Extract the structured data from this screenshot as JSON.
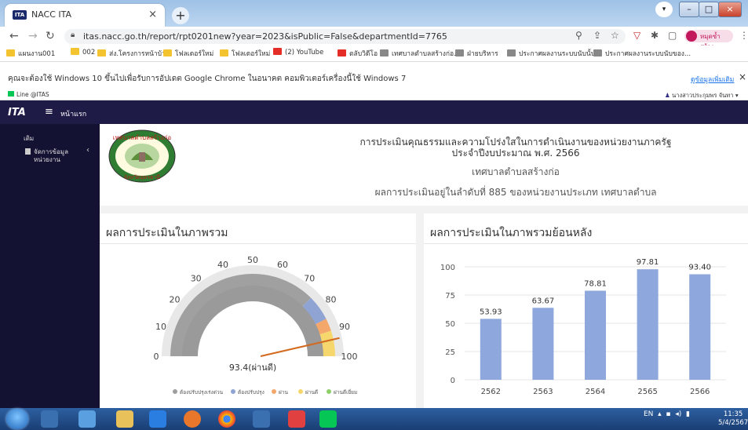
{
  "browser": {
    "tab_title": "NACC ITA",
    "tab_favicon_text": "ITA",
    "url": "itas.nacc.go.th/report/rpt0201new?year=2023&isPublic=False&departmentId=7765",
    "profile_name": "หมุดซ้ำสร้าง",
    "bookmarks": [
      {
        "label": "แผนงาน001",
        "color": "#f4c430"
      },
      {
        "label": "002",
        "color": "#f4c430"
      },
      {
        "label": "ส่ง.โครงการหน้าบ้า",
        "color": "#f4c430"
      },
      {
        "label": "โฟลเดอร์ใหม่",
        "color": "#f4c430"
      },
      {
        "label": "โฟลเดอร์ใหม่",
        "color": "#f4c430"
      },
      {
        "label": "(2) YouTube",
        "color": "#e52d27"
      },
      {
        "label": "ตลับวิดีโอ",
        "color": "#e52d27"
      },
      {
        "label": "เทศบาลตำบลสร้างก่อ...",
        "color": "#888888"
      },
      {
        "label": "ฝ่ายบริหาร",
        "color": "#888888"
      },
      {
        "label": "ประกาศผลงานระบบนับนั้น...",
        "color": "#888888"
      },
      {
        "label": "ประกาศผลงานระบบนับของ...",
        "color": "#888888"
      }
    ],
    "info_message": "คุณจะต้องใช้ Windows 10 ขึ้นไปเพื่อรับการอัปเดต Google Chrome ในอนาคต คอมพิวเตอร์เครื่องนี้ใช้ Windows 7",
    "info_link": "ดูข้อมูลเพิ่มเติม",
    "line_label": "Line @ITAS",
    "logged_user": "นางสาวประกุมพร จันทา"
  },
  "app": {
    "logo": "ITA",
    "home_label": "หน้าแรก",
    "sidebar": {
      "item1": "เดิม",
      "item2": "จัดการข้อมูล หน่วยงาน"
    }
  },
  "header": {
    "line1": "การประเมินคุณธรรมและความโปร่งใสในการดำเนินงานของหน่วยงานภาครัฐ",
    "line2": "ประจำปีงบประมาณ พ.ศ. 2566",
    "org": "เทศบาลตำบลสร้างก่อ",
    "rank": "ผลการประเมินอยู่ในลำดับที่ 885 ของหน่วยงานประเภท เทศบาลตำบล"
  },
  "seal": {
    "top_text": "เทศบาลตำบลสร้างก่อ",
    "bottom_text": "จังหวัดอุดรธานี"
  },
  "gauge_card": {
    "title": "ผลการประเมินในภาพรวม",
    "value": 93.4,
    "value_label": "93.4(ผ่านดี)",
    "ticks": [
      "0",
      "10",
      "20",
      "30",
      "40",
      "50",
      "60",
      "70",
      "80",
      "90",
      "100"
    ],
    "legend": [
      {
        "label": "ต้องปรับปรุงเร่งด่วน",
        "color": "#9e9e9e"
      },
      {
        "label": "ต้องปรับปรุง",
        "color": "#90a4d4"
      },
      {
        "label": "ผ่าน",
        "color": "#f3a76a"
      },
      {
        "label": "ผ่านดี",
        "color": "#f5d76e"
      },
      {
        "label": "ผ่านดีเยี่ยม",
        "color": "#8fcf6b"
      }
    ]
  },
  "chart_card": {
    "title": "ผลการประเมินในภาพรวมย้อนหลัง"
  },
  "chart_data": {
    "type": "bar",
    "categories": [
      "2562",
      "2563",
      "2564",
      "2565",
      "2566"
    ],
    "values": [
      53.93,
      63.67,
      78.81,
      97.81,
      93.4
    ],
    "value_labels": [
      "53.93",
      "63.67",
      "78.81",
      "97.81",
      "93.40"
    ],
    "ylim": [
      0,
      100
    ],
    "yticks": [
      "0",
      "25",
      "50",
      "75",
      "100"
    ],
    "bar_color": "#8ea7dc"
  },
  "taskbar": {
    "lang": "EN",
    "time": "11:35",
    "date": "5/4/2567"
  }
}
